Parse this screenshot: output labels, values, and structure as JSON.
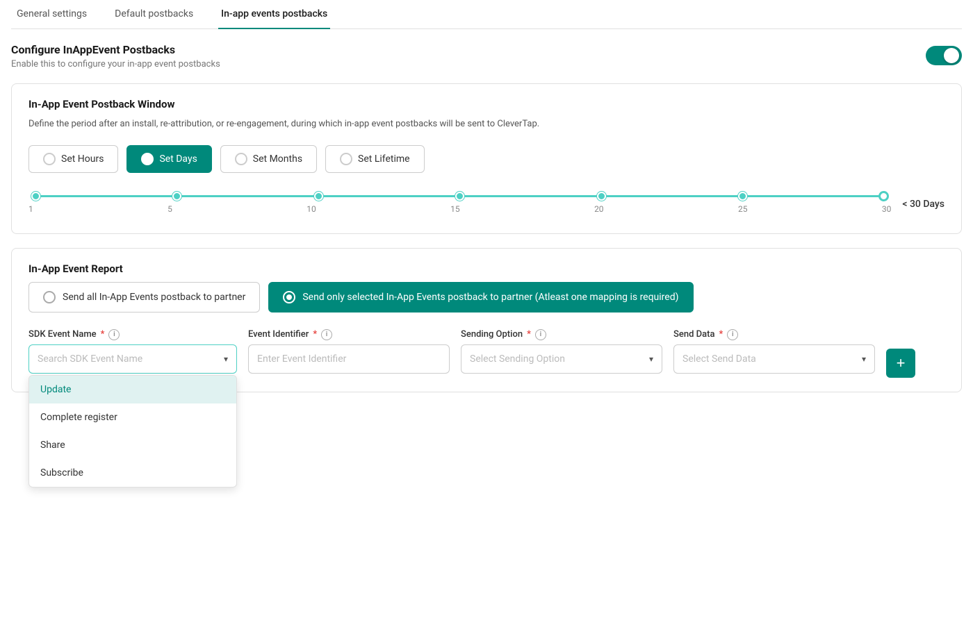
{
  "tabs": [
    {
      "id": "general",
      "label": "General settings",
      "active": false
    },
    {
      "id": "default",
      "label": "Default postbacks",
      "active": false
    },
    {
      "id": "inapp",
      "label": "In-app events postbacks",
      "active": true
    }
  ],
  "configure": {
    "title": "Configure InAppEvent Postbacks",
    "description": "Enable this to configure your in-app event postbacks",
    "toggle_enabled": true
  },
  "postback_window": {
    "title": "In-App Event Postback Window",
    "description": "Define the period after an install, re-attribution, or re-engagement, during which in-app event postbacks will be sent to CleverTap.",
    "options": [
      {
        "id": "hours",
        "label": "Set Hours",
        "selected": false
      },
      {
        "id": "days",
        "label": "Set Days",
        "selected": true
      },
      {
        "id": "months",
        "label": "Set Months",
        "selected": false
      },
      {
        "id": "lifetime",
        "label": "Set Lifetime",
        "selected": false
      }
    ],
    "slider": {
      "min": 1,
      "max": 30,
      "value": 30,
      "label": "< 30 Days",
      "ticks": [
        1,
        5,
        10,
        15,
        20,
        25,
        30
      ]
    }
  },
  "event_report": {
    "title": "In-App Event Report",
    "options": [
      {
        "id": "all",
        "label": "Send all In-App Events postback to partner",
        "selected": false
      },
      {
        "id": "selected",
        "label": "Send only selected In-App Events postback to partner (Atleast one mapping is required)",
        "selected": true
      }
    ],
    "fields": {
      "sdk_event_name": {
        "label": "SDK Event Name",
        "required": true,
        "placeholder": "Search SDK Event Name"
      },
      "event_identifier": {
        "label": "Event Identifier",
        "required": true,
        "placeholder": "Enter Event Identifier"
      },
      "sending_option": {
        "label": "Sending Option",
        "required": true,
        "placeholder": "Select Sending Option"
      },
      "send_data": {
        "label": "Send Data",
        "required": true,
        "placeholder": "Select Send Data"
      }
    },
    "dropdown_items": [
      {
        "label": "Update",
        "highlighted": true
      },
      {
        "label": "Complete register",
        "highlighted": false
      },
      {
        "label": "Share",
        "highlighted": false
      },
      {
        "label": "Subscribe",
        "highlighted": false
      }
    ]
  },
  "icons": {
    "chevron_down": "▾",
    "info": "i",
    "plus": "+"
  },
  "colors": {
    "teal": "#00897B",
    "teal_light": "#4DD0C4",
    "teal_bg": "#e0f2f1"
  }
}
